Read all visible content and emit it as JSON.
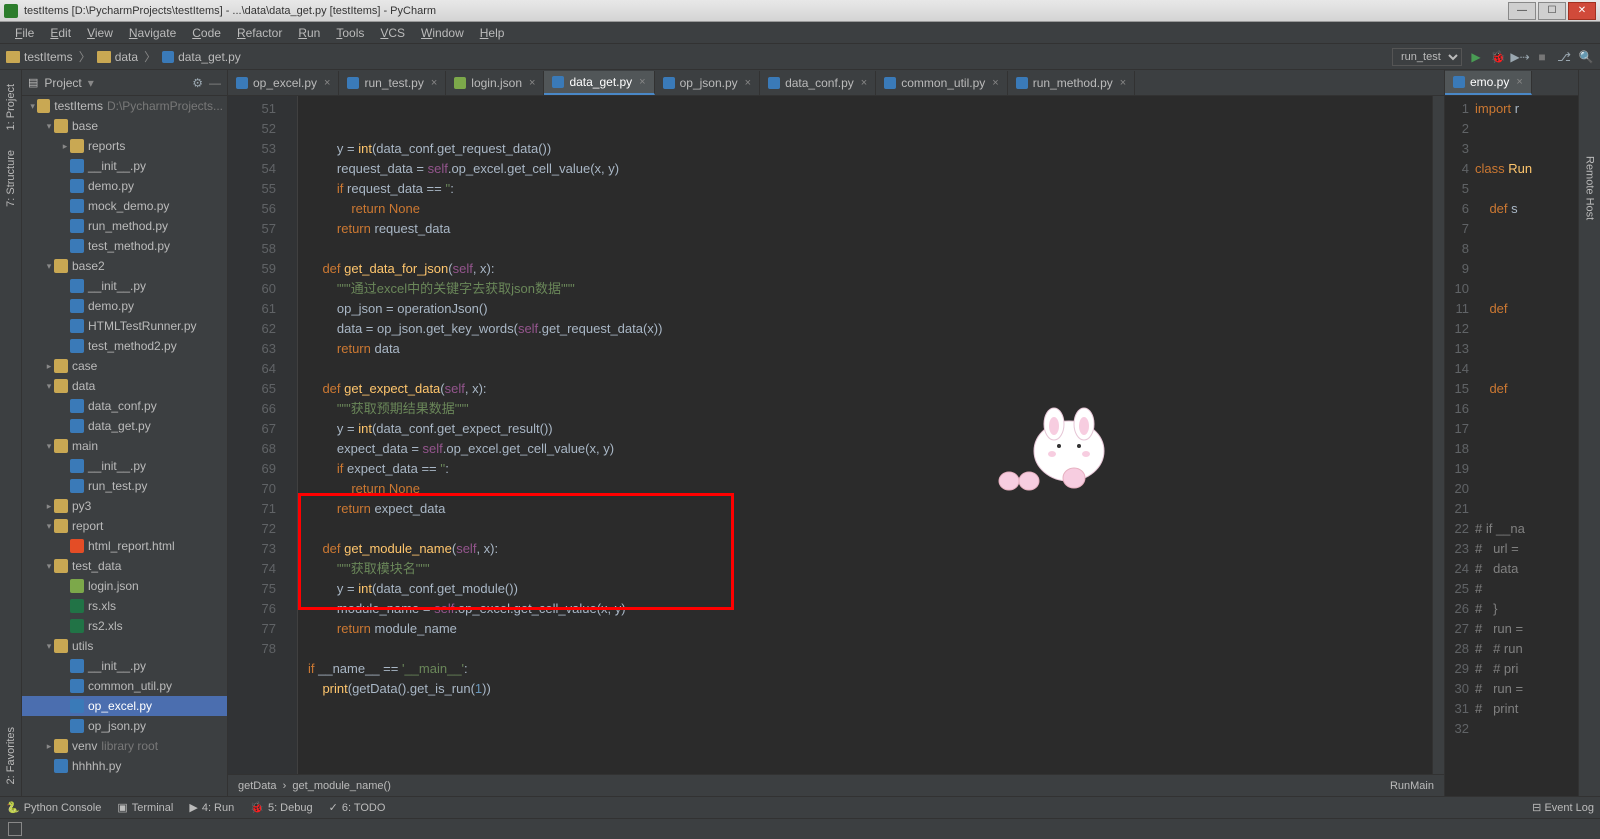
{
  "window_title": "testItems [D:\\PycharmProjects\\testItems] - ...\\data\\data_get.py [testItems] - PyCharm",
  "menu": [
    "File",
    "Edit",
    "View",
    "Navigate",
    "Code",
    "Refactor",
    "Run",
    "Tools",
    "VCS",
    "Window",
    "Help"
  ],
  "crumbs": [
    "testItems",
    "data",
    "data_get.py"
  ],
  "run_config": "run_test",
  "sidebar_title": "Project",
  "tree": [
    {
      "d": 0,
      "a": "▾",
      "i": "fold",
      "t": "testItems",
      "dim": "D:\\PycharmProjects..."
    },
    {
      "d": 1,
      "a": "▾",
      "i": "fold",
      "t": "base"
    },
    {
      "d": 2,
      "a": "▸",
      "i": "fold",
      "t": "reports"
    },
    {
      "d": 2,
      "a": "",
      "i": "py",
      "t": "__init__.py"
    },
    {
      "d": 2,
      "a": "",
      "i": "py",
      "t": "demo.py"
    },
    {
      "d": 2,
      "a": "",
      "i": "py",
      "t": "mock_demo.py"
    },
    {
      "d": 2,
      "a": "",
      "i": "py",
      "t": "run_method.py"
    },
    {
      "d": 2,
      "a": "",
      "i": "py",
      "t": "test_method.py"
    },
    {
      "d": 1,
      "a": "▾",
      "i": "fold",
      "t": "base2"
    },
    {
      "d": 2,
      "a": "",
      "i": "py",
      "t": "__init__.py"
    },
    {
      "d": 2,
      "a": "",
      "i": "py",
      "t": "demo.py"
    },
    {
      "d": 2,
      "a": "",
      "i": "py",
      "t": "HTMLTestRunner.py"
    },
    {
      "d": 2,
      "a": "",
      "i": "py",
      "t": "test_method2.py"
    },
    {
      "d": 1,
      "a": "▸",
      "i": "fold",
      "t": "case"
    },
    {
      "d": 1,
      "a": "▾",
      "i": "fold",
      "t": "data"
    },
    {
      "d": 2,
      "a": "",
      "i": "py",
      "t": "data_conf.py"
    },
    {
      "d": 2,
      "a": "",
      "i": "py",
      "t": "data_get.py"
    },
    {
      "d": 1,
      "a": "▾",
      "i": "fold",
      "t": "main"
    },
    {
      "d": 2,
      "a": "",
      "i": "py",
      "t": "__init__.py"
    },
    {
      "d": 2,
      "a": "",
      "i": "py",
      "t": "run_test.py"
    },
    {
      "d": 1,
      "a": "▸",
      "i": "fold",
      "t": "py3"
    },
    {
      "d": 1,
      "a": "▾",
      "i": "fold",
      "t": "report"
    },
    {
      "d": 2,
      "a": "",
      "i": "html",
      "t": "html_report.html"
    },
    {
      "d": 1,
      "a": "▾",
      "i": "fold",
      "t": "test_data"
    },
    {
      "d": 2,
      "a": "",
      "i": "json",
      "t": "login.json"
    },
    {
      "d": 2,
      "a": "",
      "i": "xls",
      "t": "rs.xls"
    },
    {
      "d": 2,
      "a": "",
      "i": "xls",
      "t": "rs2.xls"
    },
    {
      "d": 1,
      "a": "▾",
      "i": "fold",
      "t": "utils"
    },
    {
      "d": 2,
      "a": "",
      "i": "py",
      "t": "__init__.py"
    },
    {
      "d": 2,
      "a": "",
      "i": "py",
      "t": "common_util.py"
    },
    {
      "d": 2,
      "a": "",
      "i": "py",
      "t": "op_excel.py",
      "sel": true
    },
    {
      "d": 2,
      "a": "",
      "i": "py",
      "t": "op_json.py"
    },
    {
      "d": 1,
      "a": "▸",
      "i": "fold",
      "t": "venv",
      "dim": "library root"
    },
    {
      "d": 1,
      "a": "",
      "i": "py",
      "t": "hhhhh.py"
    }
  ],
  "tabs": [
    {
      "t": "op_excel.py",
      "i": "py"
    },
    {
      "t": "run_test.py",
      "i": "py"
    },
    {
      "t": "login.json",
      "i": "json"
    },
    {
      "t": "data_get.py",
      "i": "py",
      "active": true
    },
    {
      "t": "op_json.py",
      "i": "py"
    },
    {
      "t": "data_conf.py",
      "i": "py"
    },
    {
      "t": "common_util.py",
      "i": "py"
    },
    {
      "t": "run_method.py",
      "i": "py"
    }
  ],
  "code_start": 51,
  "breadcrumb_bottom_left": "getData",
  "breadcrumb_bottom_mid": "get_module_name()",
  "breadcrumb_bottom_right": "RunMain",
  "right_tab": "emo.py",
  "right_start": 1,
  "bottom_items": [
    "Python Console",
    "Terminal",
    "4: Run",
    "5: Debug",
    "6: TODO"
  ],
  "event_log": "Event Log"
}
